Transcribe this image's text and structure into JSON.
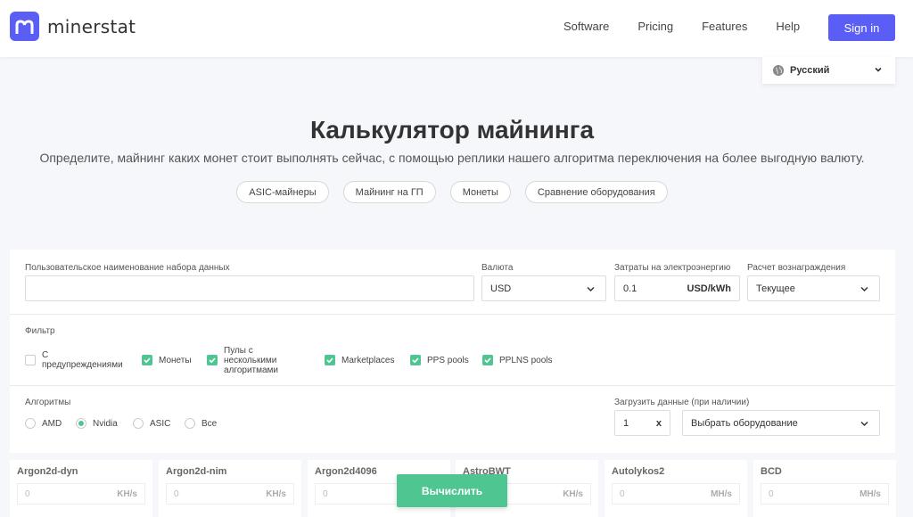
{
  "header": {
    "logo_text": "minerstat",
    "nav": [
      "Software",
      "Pricing",
      "Features",
      "Help"
    ],
    "signin_label": "Sign in"
  },
  "language": {
    "selected": "Русский"
  },
  "hero": {
    "title": "Калькулятор майнинга",
    "subtitle": "Определите, майнинг каких монет стоит выполнять сейчас, с помощью реплики нашего алгоритма переключения на более выгодную валюту.",
    "pills": [
      "ASIC-майнеры",
      "Майнинг на ГП",
      "Монеты",
      "Сравнение оборудования"
    ]
  },
  "form": {
    "dataset_name_label": "Пользовательское наименование набора данных",
    "dataset_name_value": "",
    "currency_label": "Валюта",
    "currency_value": "USD",
    "power_cost_label": "Затраты на электроэнергию",
    "power_cost_value": "0.1",
    "power_cost_unit": "USD/kWh",
    "reward_label": "Расчет вознаграждения",
    "reward_value": "Текущее",
    "filter_label": "Фильтр",
    "filters": [
      {
        "label_lines": [
          "С",
          "предупреждениями"
        ],
        "checked": false
      },
      {
        "label_lines": [
          "Монеты"
        ],
        "checked": true
      },
      {
        "label_lines": [
          "Пулы с",
          "несколькими",
          "алгоритмами"
        ],
        "checked": true
      },
      {
        "label_lines": [
          "Marketplaces"
        ],
        "checked": true
      },
      {
        "label_lines": [
          "PPS pools"
        ],
        "checked": true
      },
      {
        "label_lines": [
          "PPLNS pools"
        ],
        "checked": true
      }
    ],
    "algorithms_label": "Алгоритмы",
    "algorithms": [
      {
        "label": "AMD",
        "selected": false
      },
      {
        "label": "Nvidia",
        "selected": true
      },
      {
        "label": "ASIC",
        "selected": false
      },
      {
        "label": "Все",
        "selected": false
      }
    ],
    "load_label": "Загрузить данные (при наличии)",
    "load_qty": "1",
    "load_qty_clear": "x",
    "hardware_placeholder": "Выбрать оборудование"
  },
  "algos": [
    {
      "name": "Argon2d-dyn",
      "value": "0",
      "unit": "KH/s"
    },
    {
      "name": "Argon2d-nim",
      "value": "0",
      "unit": "KH/s"
    },
    {
      "name": "Argon2d4096",
      "value": "0",
      "unit": ""
    },
    {
      "name": "AstroBWT",
      "value": "",
      "unit": "KH/s"
    },
    {
      "name": "Autolykos2",
      "value": "0",
      "unit": "MH/s"
    },
    {
      "name": "BCD",
      "value": "0",
      "unit": "MH/s"
    }
  ],
  "calculate_label": "Вычислить",
  "colors": {
    "accent": "#5b5ef4",
    "green": "#4fc692"
  }
}
